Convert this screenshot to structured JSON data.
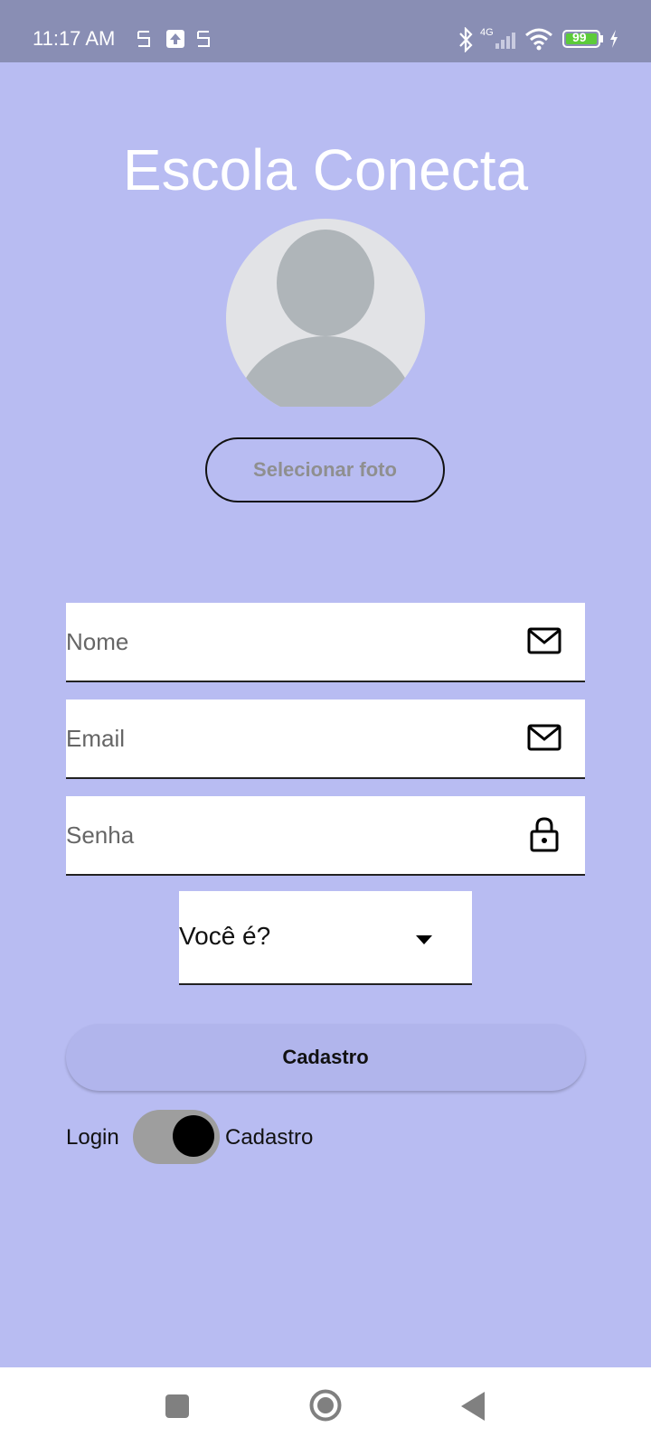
{
  "status_bar": {
    "time": "11:17 AM",
    "network": "4G",
    "battery": "99"
  },
  "app": {
    "title": "Escola Conecta",
    "select_photo_label": "Selecionar foto"
  },
  "form": {
    "fields": [
      {
        "label": "Nome",
        "icon": "mail-icon"
      },
      {
        "label": "Email",
        "icon": "mail-icon"
      },
      {
        "label": "Senha",
        "icon": "lock-icon"
      }
    ],
    "role_select": {
      "value": "Você é?"
    },
    "submit_label": "Cadastro"
  },
  "mode_toggle": {
    "left_label": "Login",
    "right_label": "Cadastro",
    "active": "Cadastro"
  },
  "colors": {
    "background": "#b8bcf2",
    "status_bar": "#898eb4",
    "button": "#b1b5ec",
    "battery": "#5ccb3a"
  }
}
